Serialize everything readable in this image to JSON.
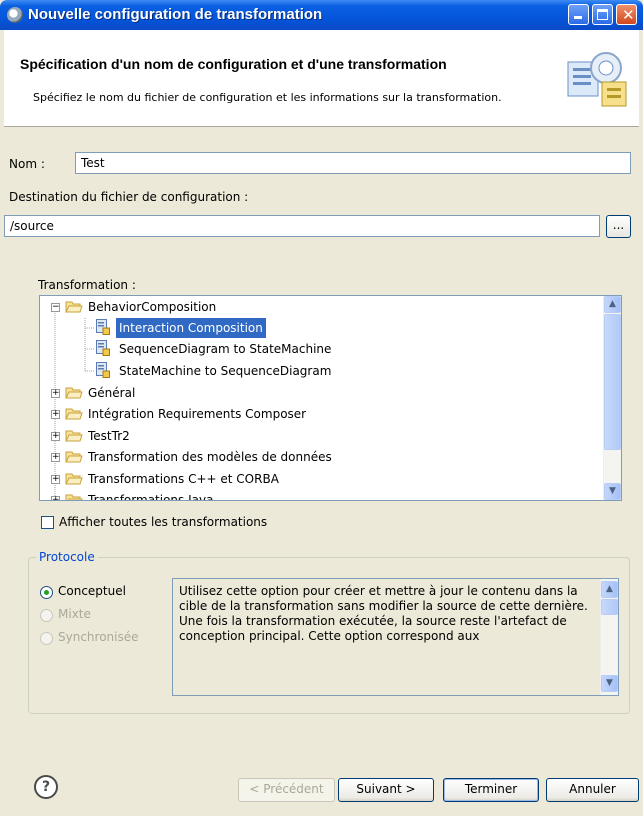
{
  "window": {
    "title": "Nouvelle configuration de transformation"
  },
  "header": {
    "title": "Spécification d'un nom de configuration et d'une transformation",
    "description": "Spécifiez le nom du fichier de configuration et les informations sur la transformation."
  },
  "form": {
    "name_label": "Nom :",
    "name_value": "Test",
    "destination_label": "Destination du fichier de configuration :",
    "destination_value": "/source",
    "browse_label": "...",
    "transformation_label": "Transformation :"
  },
  "tree": {
    "items": [
      {
        "label": "BehaviorComposition",
        "type": "folder",
        "expanded": true
      },
      {
        "label": "Interaction Composition",
        "type": "transform",
        "selected": true
      },
      {
        "label": "SequenceDiagram to StateMachine",
        "type": "transform"
      },
      {
        "label": "StateMachine to SequenceDiagram",
        "type": "transform"
      },
      {
        "label": "Général",
        "type": "folder",
        "expanded": false
      },
      {
        "label": "Intégration Requirements Composer",
        "type": "folder",
        "expanded": false
      },
      {
        "label": "TestTr2",
        "type": "folder",
        "expanded": false
      },
      {
        "label": "Transformation des modèles de données",
        "type": "folder",
        "expanded": false
      },
      {
        "label": "Transformations C++ et CORBA",
        "type": "folder",
        "expanded": false
      },
      {
        "label": "Transformations Java",
        "type": "folder",
        "expanded": false
      }
    ]
  },
  "show_all": {
    "label": "Afficher toutes les transformations",
    "checked": false
  },
  "protocol": {
    "group_label": "Protocole",
    "options": [
      {
        "label": "Conceptuel",
        "selected": true,
        "enabled": true
      },
      {
        "label": "Mixte",
        "selected": false,
        "enabled": false
      },
      {
        "label": "Synchronisée",
        "selected": false,
        "enabled": false
      }
    ],
    "description": "Utilisez cette option pour créer et mettre à jour le contenu dans la cible de la transformation sans modifier la source de cette dernière. Une fois la transformation exécutée, la source reste l'artefact de conception principal. Cette option correspond aux"
  },
  "buttons": {
    "help": "?",
    "previous": "< Précédent",
    "next": "Suivant >",
    "finish": "Terminer",
    "cancel": "Annuler"
  },
  "colors": {
    "titlebar": "#0556dc",
    "selection": "#316ac5",
    "group_label": "#0046d5"
  }
}
